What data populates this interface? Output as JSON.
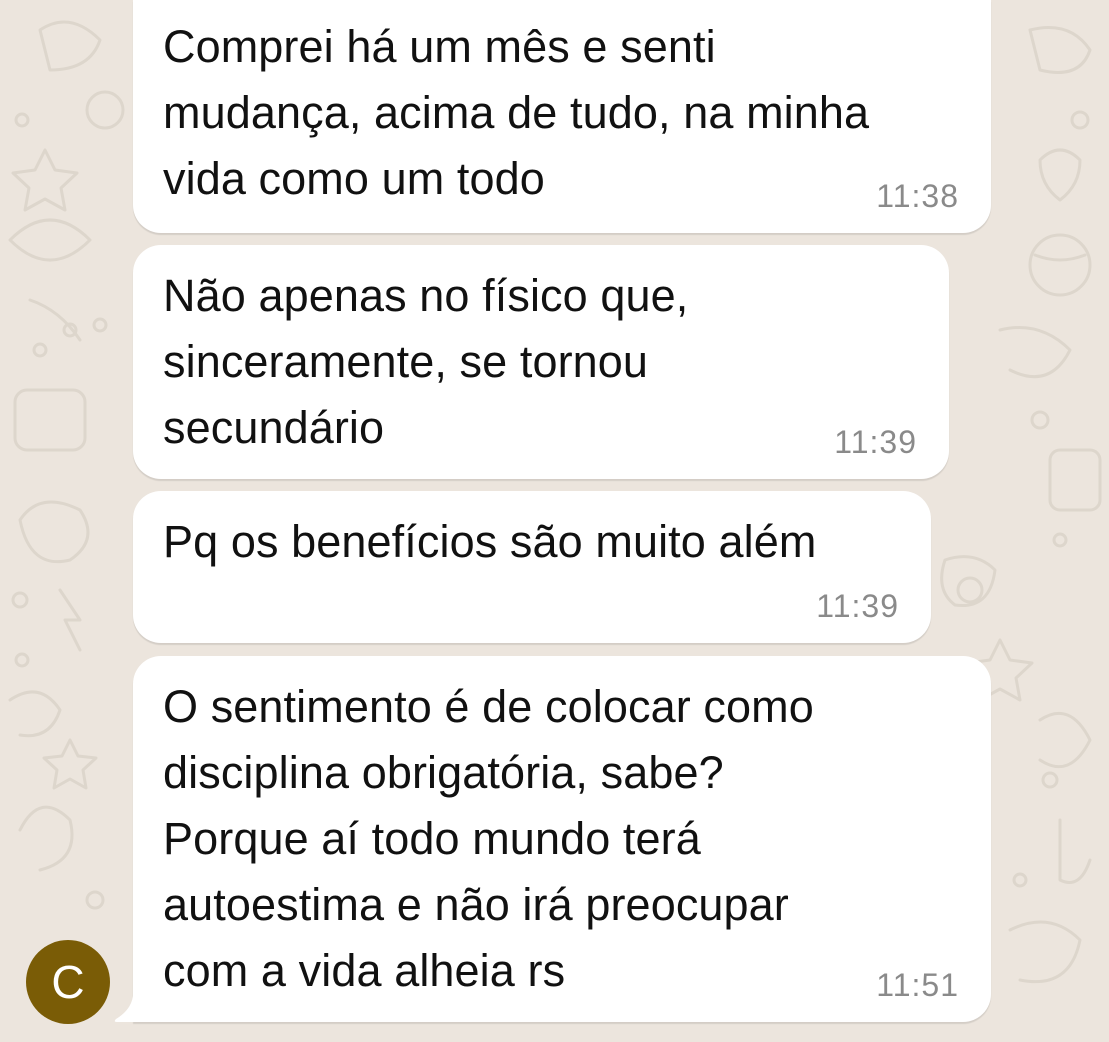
{
  "chat": {
    "background_color": "#ece5dd",
    "bubble_color": "#ffffff",
    "sender_avatar": {
      "initial": "C",
      "color": "#7a5c06"
    },
    "messages": [
      {
        "text": "Comprei há um mês e senti\nmudança, acima de tudo, na minha\nvida como um todo",
        "time": "11:38"
      },
      {
        "text": "Não apenas no físico que,\nsinceramente, se tornou\nsecundário",
        "time": "11:39"
      },
      {
        "text": "Pq os benefícios são muito além",
        "time": "11:39"
      },
      {
        "text": "O sentimento é de colocar como\ndisciplina obrigatória, sabe?\nPorque aí todo mundo terá\nautoestima e não irá preocupar\ncom a vida alheia rs",
        "time": "11:51"
      }
    ]
  }
}
